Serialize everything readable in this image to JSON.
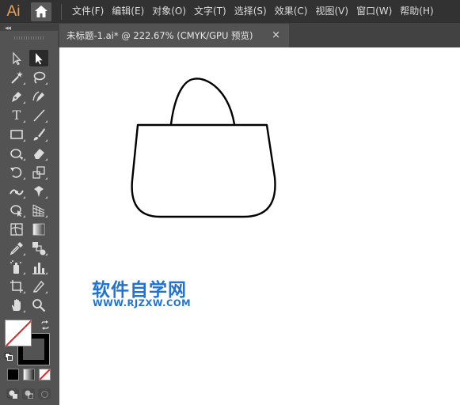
{
  "app": {
    "logo_text": "Ai",
    "accent_color": "#f29d52"
  },
  "menu": {
    "items": [
      "文件(F)",
      "编辑(E)",
      "对象(O)",
      "文字(T)",
      "选择(S)",
      "效果(C)",
      "视图(V)",
      "窗口(W)",
      "帮助(H)"
    ]
  },
  "document_tab": {
    "title": "未标题-1.ai* @ 222.67% (CMYK/GPU 预览)",
    "close_glyph": "×"
  },
  "panel": {
    "collapse_glyph": "◂◂"
  },
  "tools": [
    {
      "name": "selection-tool-icon"
    },
    {
      "name": "direct-selection-tool-icon",
      "active": true
    },
    {
      "name": "magic-wand-tool-icon"
    },
    {
      "name": "lasso-tool-icon"
    },
    {
      "name": "pen-tool-icon"
    },
    {
      "name": "curvature-tool-icon"
    },
    {
      "name": "type-tool-icon",
      "glyph": "T"
    },
    {
      "name": "line-segment-tool-icon"
    },
    {
      "name": "rectangle-tool-icon"
    },
    {
      "name": "paintbrush-tool-icon"
    },
    {
      "name": "shaper-tool-icon"
    },
    {
      "name": "eraser-tool-icon"
    },
    {
      "name": "rotate-tool-icon"
    },
    {
      "name": "scale-tool-icon"
    },
    {
      "name": "width-tool-icon"
    },
    {
      "name": "puppet-warp-tool-icon"
    },
    {
      "name": "shape-builder-tool-icon"
    },
    {
      "name": "perspective-grid-tool-icon"
    },
    {
      "name": "mesh-tool-icon"
    },
    {
      "name": "gradient-tool-icon"
    },
    {
      "name": "eyedropper-tool-icon"
    },
    {
      "name": "blend-tool-icon"
    },
    {
      "name": "symbol-sprayer-tool-icon"
    },
    {
      "name": "column-graph-tool-icon"
    },
    {
      "name": "artboard-tool-icon"
    },
    {
      "name": "slice-tool-icon"
    },
    {
      "name": "hand-tool-icon"
    },
    {
      "name": "zoom-tool-icon"
    }
  ],
  "colors": {
    "fill": "none",
    "stroke": "#000000",
    "canvas": "#ffffff",
    "ui_dark": "#323232"
  },
  "watermark": {
    "title": "软件自学网",
    "url": "WWW.RJZXW.COM",
    "color": "#1f73d6"
  }
}
